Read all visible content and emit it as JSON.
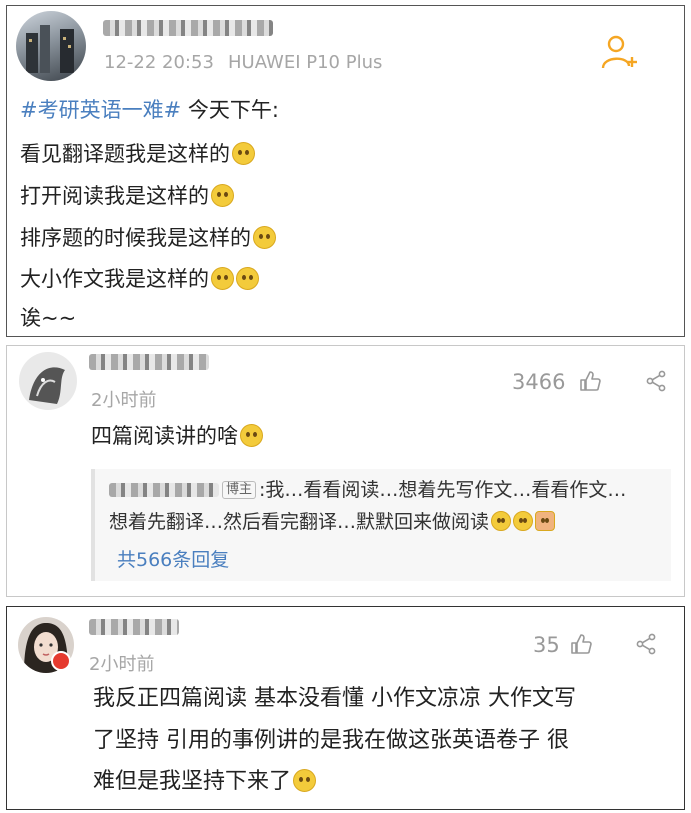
{
  "post": {
    "username": "",
    "timestamp": "12-22 20:53",
    "device": "HUAWEI P10 Plus",
    "hashtag": "#考研英语一难#",
    "lines": [
      " 今天下午:",
      "看见翻译题我是这样的",
      "打开阅读我是这样的",
      "排序题的时候我是这样的",
      "大小作文我是这样的",
      "诶~~"
    ],
    "follow_icon": "add-user-icon"
  },
  "comment1": {
    "time": "2小时前",
    "likes": "3466",
    "text": "四篇阅读讲的啥",
    "quote_badge": "博主",
    "quote_line1": ":我…看看阅读…想着先写作文…看看作文…",
    "quote_line2": "想着先翻译…然后看完翻译…默默回来做阅读",
    "reply_count": "共566条回复"
  },
  "comment2": {
    "time": "2小时前",
    "likes": "35",
    "lines": [
      "我反正四篇阅读 基本没看懂 小作文凉凉 大作文写",
      "了坚持 引用的事例讲的是我在做这张英语卷子 很",
      "难但是我坚持下来了"
    ]
  },
  "colors": {
    "link": "#4a7fbf",
    "meta": "#a6a6a6",
    "follow": "#f5a623"
  }
}
